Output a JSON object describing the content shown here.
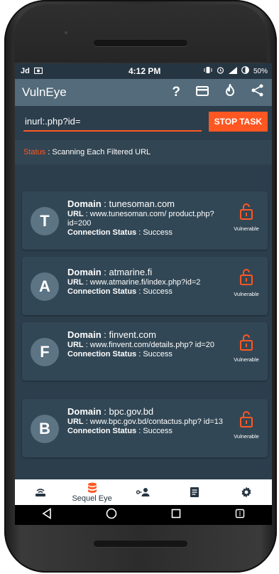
{
  "statusbar": {
    "left_1": "Jd",
    "left_2": "📷",
    "time": "4:12 PM",
    "battery": "50%"
  },
  "appbar": {
    "title": "VulnEye"
  },
  "search": {
    "value": "inurl:.php?id=",
    "button": "STOP TASK"
  },
  "status": {
    "label": "Status",
    "text": " : Scanning Each Filtered URL"
  },
  "results": [
    {
      "letter": "T",
      "domain": "tunesoman.com",
      "url": "www.tunesoman.com/ product.php?id=200",
      "conn": "Success",
      "badge": "Vulnerable"
    },
    {
      "letter": "A",
      "domain": "atmarine.fi",
      "url": "www.atmarine.fi/index.php?id=2",
      "conn": "Success",
      "badge": "Vulnerable"
    },
    {
      "letter": "F",
      "domain": "finvent.com",
      "url": "www.finvent.com/details.php? id=20",
      "conn": "Success",
      "badge": "Vulnerable"
    },
    {
      "letter": "B",
      "domain": "bpc.gov.bd",
      "url": "www.bpc.gov.bd/contactus.php? id=13",
      "conn": "Success",
      "badge": "Vulnerable"
    }
  ],
  "labels": {
    "domain": "Domain",
    "url": "URL",
    "conn": "Connection Status"
  },
  "bottomnav": {
    "active_label": "Sequel Eye"
  },
  "colors": {
    "accent": "#ff5722",
    "appbar": "#536b7a",
    "background": "#2c3e4c"
  }
}
